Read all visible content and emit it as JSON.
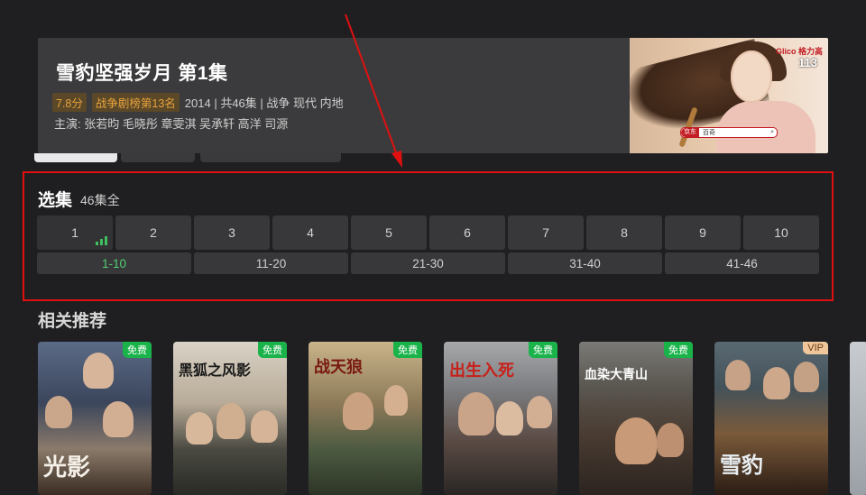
{
  "header": {
    "title": "雪豹坚强岁月 第1集",
    "rating": "7.8分",
    "rank": "战争剧榜第13名",
    "meta": "2014 | 共46集 | 战争 现代 内地",
    "cast": "主演: 张若昀 毛晓彤 章雯淇 吴承轩 高洋 司源"
  },
  "promo": {
    "brand": "Glico 格力高",
    "count": "113",
    "search_brand": "京东",
    "search_query": "百奇"
  },
  "episodes": {
    "title": "选集",
    "total": "46集全",
    "items": [
      "1",
      "2",
      "3",
      "4",
      "5",
      "6",
      "7",
      "8",
      "9",
      "10"
    ],
    "playing_index": 0,
    "ranges": [
      "1-10",
      "11-20",
      "21-30",
      "31-40",
      "41-46"
    ],
    "active_range_index": 0
  },
  "recommend": {
    "title": "相关推荐",
    "posters": [
      {
        "title_text": "光影",
        "tag": "免费"
      },
      {
        "title_text": "黑狐之风影",
        "tag": "免费"
      },
      {
        "title_text": "战天狼",
        "tag": "免费"
      },
      {
        "title_text": "出生入死",
        "tag": "免费"
      },
      {
        "title_text": "血染大青山",
        "tag": "免费"
      },
      {
        "title_text": "雪豹",
        "tag": "VIP"
      }
    ]
  },
  "colors": {
    "annotation_red": "#e01010",
    "playing_green": "#3fbf5f",
    "free_tag": "#19b34a",
    "vip_tag": "#f0c79b"
  }
}
